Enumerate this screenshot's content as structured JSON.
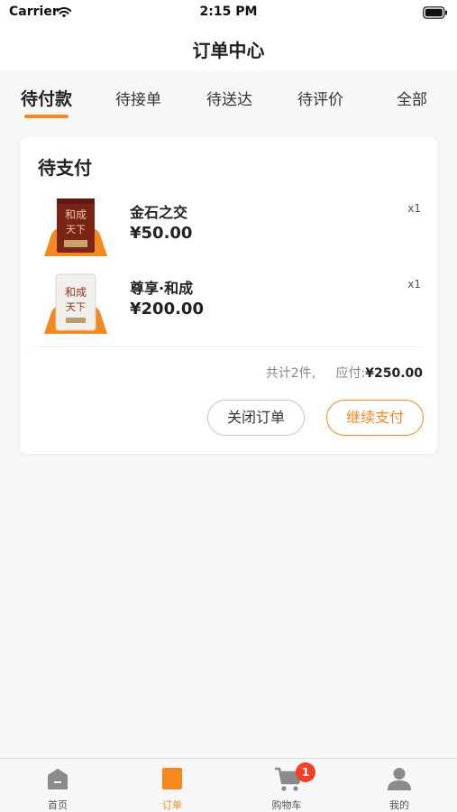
{
  "status_bar": {
    "carrier": "Carrier",
    "time": "2:15 PM",
    "wifi_icon": "wifi-icon",
    "battery_icon": "battery-icon"
  },
  "nav": {
    "title": "订单中心"
  },
  "tabs": [
    {
      "label": "待付款",
      "active": true
    },
    {
      "label": "待接单",
      "active": false
    },
    {
      "label": "待送达",
      "active": false
    },
    {
      "label": "待评价",
      "active": false
    },
    {
      "label": "全部",
      "active": false
    }
  ],
  "order": {
    "status": "待支付",
    "items": [
      {
        "name": "金石之交",
        "price": "¥50.00",
        "qty": "x1",
        "thumb_icon": "tea-package-dark-icon"
      },
      {
        "name": "尊享·和成",
        "price": "¥200.00",
        "qty": "x1",
        "thumb_icon": "tea-package-light-icon"
      }
    ],
    "count_text": "共计2件,",
    "total_label": "应付:",
    "total_amount": "¥250.00",
    "close_button": "关闭订单",
    "pay_button": "继续支付"
  },
  "tabbar": [
    {
      "label": "首页",
      "icon": "home-icon",
      "active": false
    },
    {
      "label": "订单",
      "icon": "order-icon",
      "active": true
    },
    {
      "label": "购物车",
      "icon": "cart-icon",
      "active": false,
      "badge": "1"
    },
    {
      "label": "我的",
      "icon": "user-icon",
      "active": false
    }
  ],
  "colors": {
    "accent": "#f5891f",
    "badge": "#f04124",
    "background": "#f7f7f7"
  }
}
